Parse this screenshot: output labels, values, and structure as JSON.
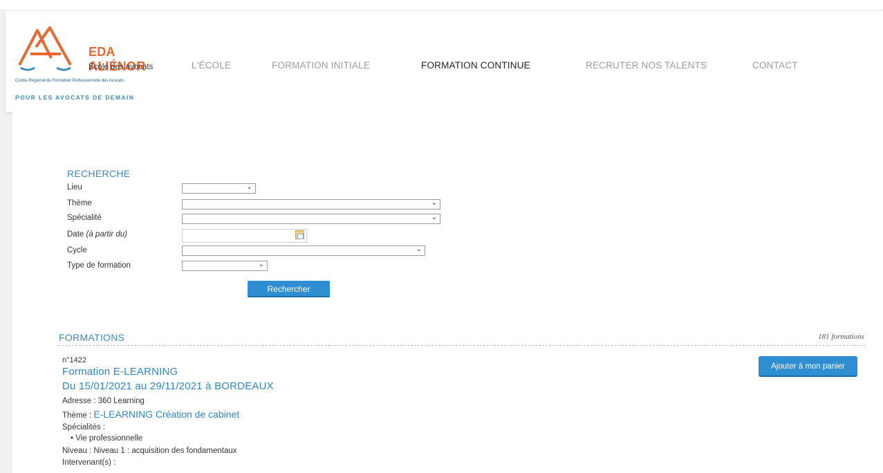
{
  "header": {
    "logo": {
      "title": "EDA ALIÉNOR",
      "subtitle": "École des avocats",
      "tiny": "Centre Régional de Formation Professionnelle des Avocats",
      "tagline": "POUR LES AVOCATS DE DEMAIN"
    },
    "nav": [
      {
        "label": "L'ÉCOLE"
      },
      {
        "label": "FORMATION INITIALE"
      },
      {
        "label": "FORMATION CONTINUE"
      },
      {
        "label": "RECRUTER NOS TALENTS"
      },
      {
        "label": "CONTACT"
      }
    ],
    "active_nav": "FORMATION CONTINUE"
  },
  "search": {
    "title": "RECHERCHE",
    "fields": {
      "lieu": {
        "label": "Lieu",
        "value": ""
      },
      "theme": {
        "label": "Thème",
        "value": ""
      },
      "specialite": {
        "label": "Spécialité",
        "value": ""
      },
      "date": {
        "label": "Date",
        "hint": "(à partir du)",
        "value": ""
      },
      "cycle": {
        "label": "Cycle",
        "value": ""
      },
      "type": {
        "label": "Type de formation",
        "value": ""
      }
    },
    "button": "Rechercher"
  },
  "formations": {
    "title": "FORMATIONS",
    "count": "181 formations",
    "items": [
      {
        "number": "n°1422",
        "title": "Formation E-LEARNING",
        "dates": "Du 15/01/2021 au 29/11/2021 à BORDEAUX",
        "address_label": "Adresse :",
        "address": "360 Learning",
        "theme_label": "Thème :",
        "theme": "E-LEARNING Création de cabinet",
        "specialites_label": "Spécialités :",
        "specialites": [
          "Vie professionnelle"
        ],
        "niveau_label": "Niveau :",
        "niveau": "Niveau 1 : acquisition des fondamentaux",
        "intervenants_label": "Intervenant(s) :",
        "cart_button": "Ajouter à mon panier"
      }
    ]
  },
  "colors": {
    "accent": "#2f8dd1",
    "link": "#2f86c6",
    "brand_orange": "#e9682f"
  }
}
